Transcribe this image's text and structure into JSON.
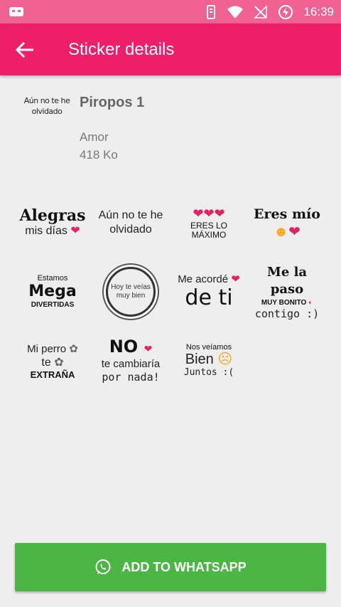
{
  "status_bar": {
    "time": "16:39"
  },
  "app_bar": {
    "title": "Sticker details"
  },
  "pack": {
    "thumbnail_text": "Aún no te he olvidado",
    "name": "Piropos 1",
    "author": "Amor",
    "size": "418 Ko"
  },
  "stickers": [
    {
      "line1": "Alegras",
      "line2": "mis días"
    },
    {
      "line1": "Aún no te he",
      "line2": "olvidado"
    },
    {
      "line1": "ERES LO MÁXIMO"
    },
    {
      "line1": "Eres mío"
    },
    {
      "line1": "Estamos",
      "line2": "Mega",
      "line3": "DIVERTIDAS"
    },
    {
      "line1": "Hoy te veías",
      "line2": "muy bien"
    },
    {
      "line1": "Me acordé",
      "line2": "de ti"
    },
    {
      "line1": "Me la paso",
      "line2": "MUY BONITO",
      "line3": "contigo :)"
    },
    {
      "line1": "Mi perro",
      "line2": "te",
      "line3": "EXTRAÑA"
    },
    {
      "line1": "NO",
      "line2": "te cambiaría",
      "line3": "por nada!"
    },
    {
      "line1": "Nos veíamos",
      "line2": "Bien",
      "line3": "Juntos :("
    }
  ],
  "add_button": {
    "label": "ADD TO WHATSAPP"
  },
  "colors": {
    "status_bar": "#f06292",
    "app_bar": "#ec1f68",
    "button": "#4cb645",
    "background": "#eeeeee"
  }
}
